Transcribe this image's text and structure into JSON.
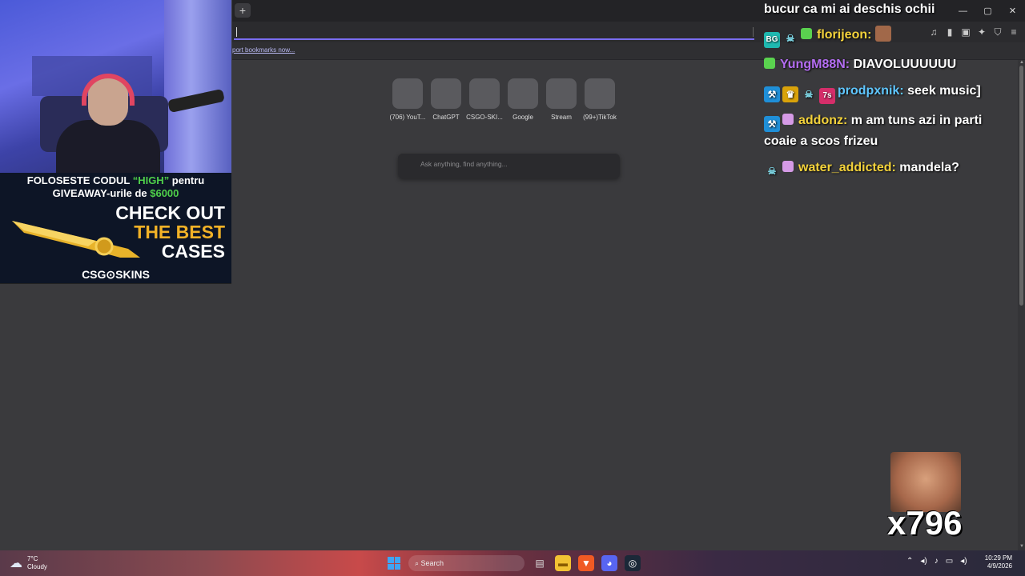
{
  "browser": {
    "new_tab": "+",
    "bookmarks_link": "port bookmarks now...",
    "window_controls": [
      "—",
      "▢",
      "✕"
    ],
    "toolbar_icons": [
      "music-icon",
      "sidebar-icon",
      "wallet-icon",
      "ai-icon",
      "shield-icon",
      "menu-icon"
    ]
  },
  "speed_dial": [
    {
      "label": "(706) YouT..."
    },
    {
      "label": "ChatGPT"
    },
    {
      "label": "CSGO-SKI..."
    },
    {
      "label": "Google"
    },
    {
      "label": "Stream"
    },
    {
      "label": "(99+)TikTok"
    }
  ],
  "search": {
    "placeholder": "Ask anything, find anything..."
  },
  "ad": {
    "line1_a": "FOLOSESTE CODUL ",
    "line1_code": "“HIGH”",
    "line1_b": " pentru",
    "line2_a": "GIVEAWAY-urile de ",
    "line2_amount": "$6000",
    "cta1": "CHECK OUT",
    "cta2": "THE BEST",
    "cta3": "CASES",
    "brand": "CSG⊙SKINS"
  },
  "chat": {
    "title": "bucur ca mi ai deschis ochii",
    "messages": [
      {
        "user": "florijeon:",
        "text": ""
      },
      {
        "user": "YungM88N:",
        "text": "DIAVOLUUUUUU"
      },
      {
        "user": "prodpxnik:",
        "text": "seek music]"
      },
      {
        "user": "addonz:",
        "text": "m am tuns azi in parti coaie a scos frizeu"
      },
      {
        "user": "water_addicted:",
        "text": "mandela?"
      }
    ],
    "emote_count": "x796"
  },
  "taskbar": {
    "temp": "7°C",
    "condition": "Cloudy",
    "search_label": "Search",
    "time": "10:29 PM",
    "date": "4/9/2026"
  },
  "colors": {
    "accent": "#7a6df0",
    "bg": "#3a3a3d",
    "chat_yellow": "#f3d23b",
    "chat_purple": "#b46df2",
    "chat_cyan": "#5fc6ff"
  }
}
